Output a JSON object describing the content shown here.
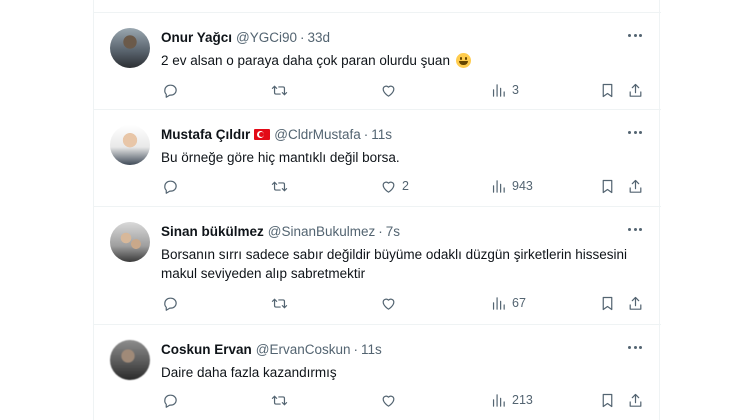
{
  "tweets": [
    {
      "name": "Onur Yağcı",
      "handle": "@YGCi90",
      "sep": "·",
      "time": "33d",
      "text": "2 ev alsan o paraya daha çok paran olurdu şuan",
      "emoji": "grinning-face",
      "replies": "",
      "retweets": "",
      "likes": "",
      "views": "3"
    },
    {
      "name": "Mustafa Çıldır",
      "flag": "turkey-flag",
      "handle": "@CldrMustafa",
      "sep": "·",
      "time": "11s",
      "text": "Bu örneğe göre hiç mantıklı değil borsa.",
      "replies": "",
      "retweets": "",
      "likes": "2",
      "views": "943"
    },
    {
      "name": "Sinan bükülmez",
      "handle": "@SinanBukulmez",
      "sep": "·",
      "time": "7s",
      "text": "Borsanın sırrı sadece sabır değildir büyüme odaklı düzgün şirketlerin hissesini makul seviyeden alıp sabretmektir",
      "replies": "",
      "retweets": "",
      "likes": "",
      "views": "67"
    },
    {
      "name": "Coskun Ervan",
      "handle": "@ErvanCoskun",
      "sep": "·",
      "time": "11s",
      "text": "Daire daha fazla kazandırmış",
      "replies": "",
      "retweets": "",
      "likes": "",
      "views": "213"
    }
  ],
  "icons": {
    "reply": "reply-icon",
    "retweet": "retweet-icon",
    "like": "heart-icon",
    "views": "views-chart-icon",
    "bookmark": "bookmark-icon",
    "share": "share-icon",
    "more": "more-dots-icon"
  },
  "colors": {
    "text": "#0f1419",
    "secondary": "#536471",
    "divider": "#eff3f4",
    "flag_red": "#e30a17"
  }
}
